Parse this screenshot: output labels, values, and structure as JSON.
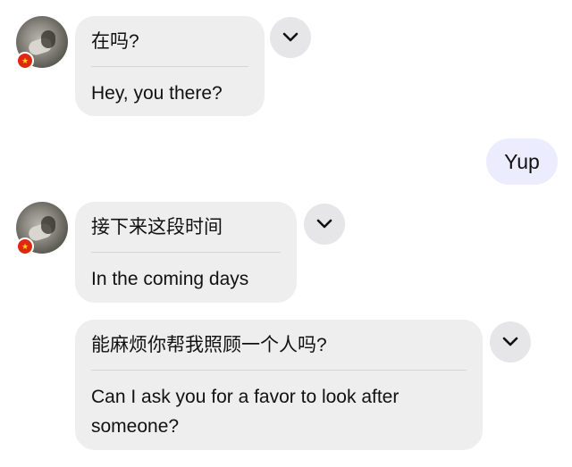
{
  "conversation": {
    "messages": [
      {
        "original": "在吗?",
        "translation": "Hey, you there?"
      },
      {
        "original": "接下来这段时间",
        "translation": "In the coming days"
      },
      {
        "original": "能麻烦你帮我照顾一个人吗?",
        "translation": "Can I ask you for a favor to look after someone?"
      }
    ],
    "outgoing": [
      {
        "text": "Yup"
      }
    ]
  },
  "icons": {
    "toggle": "chevron-down-icon",
    "flag": "china-flag-icon",
    "avatar": "contact-avatar"
  },
  "colors": {
    "incoming_bubble": "#eeeeef",
    "outgoing_bubble": "#ececff",
    "toggle_button": "#e6e6e8",
    "divider": "#d6d6d8",
    "flag": "#de2910"
  }
}
